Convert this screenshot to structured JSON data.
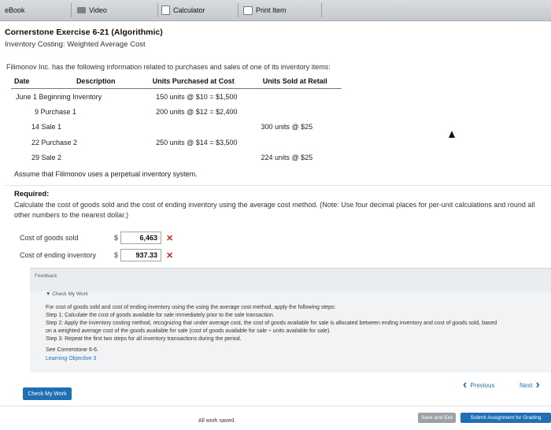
{
  "toolbar": {
    "ebook": "eBook",
    "video": "Video",
    "calculator": "Calculator",
    "print": "Print Item"
  },
  "header": {
    "title": "Cornerstone Exercise 6-21 (Algorithmic)",
    "subtitle": "Inventory Costing: Weighted Average Cost"
  },
  "intro": "Filimonov Inc. has the following information related to purchases and sales of one of its inventory items:",
  "table": {
    "headers": [
      "Date",
      "Description",
      "Units Purchased at Cost",
      "Units Sold at Retail"
    ],
    "rows": [
      {
        "date": "June 1",
        "desc": "Beginning Inventory",
        "purchased": "150 units @ $10 = $1,500",
        "sold": ""
      },
      {
        "date": "9",
        "desc": "Purchase 1",
        "purchased": "200 units @ $12 = $2,400",
        "sold": ""
      },
      {
        "date": "14",
        "desc": "Sale 1",
        "purchased": "",
        "sold": "300 units @ $25"
      },
      {
        "date": "22",
        "desc": "Purchase 2",
        "purchased": "250 units @ $14 = $3,500",
        "sold": ""
      },
      {
        "date": "29",
        "desc": "Sale 2",
        "purchased": "",
        "sold": "224 units @ $25"
      }
    ]
  },
  "assume": "Assume that Filimonov uses a perpetual inventory system.",
  "required": {
    "label": "Required:",
    "instructions": "Calculate the cost of goods sold and the cost of ending inventory using the average cost method. (Note: Use four decimal places for per-unit calculations and round all other numbers to the nearest dollar.)"
  },
  "answers": {
    "cogs_label": "Cost of goods sold",
    "cogs_currency": "$",
    "cogs_value": "6,463",
    "ending_label": "Cost of ending inventory",
    "ending_currency": "$",
    "ending_value": "937.33",
    "wrong_mark": "✕"
  },
  "feedback": {
    "label": "Feedback",
    "check_head": "▼ Check My Work",
    "line1": "For cost of goods sold and cost of ending inventory using the using the average cost method, apply the following steps:",
    "step1": "Step 1: Calculate the cost of goods available for sale immediately prior to the sale transaction.",
    "step2a": "Step 2: Apply the inventory costing method, recognizing that under average cost, the cost of goods available for sale is allocated between ending inventory and cost of goods sold, based",
    "step2b": "on a weighted average cost of the goods available for sale (cost of goods available for sale ÷ units available for sale).",
    "step3": "Step 3: Repeat the first two steps for all inventory transactions during the period.",
    "see": "See Cornerstone 6-6.",
    "learning": "Learning Objective 3"
  },
  "nav": {
    "check_my_work": "Check My Work",
    "previous": "Previous",
    "next": "Next"
  },
  "footer": {
    "saved": "All work saved.",
    "save_exit": "Save and Exit",
    "submit": "Submit Assignment for Grading"
  }
}
